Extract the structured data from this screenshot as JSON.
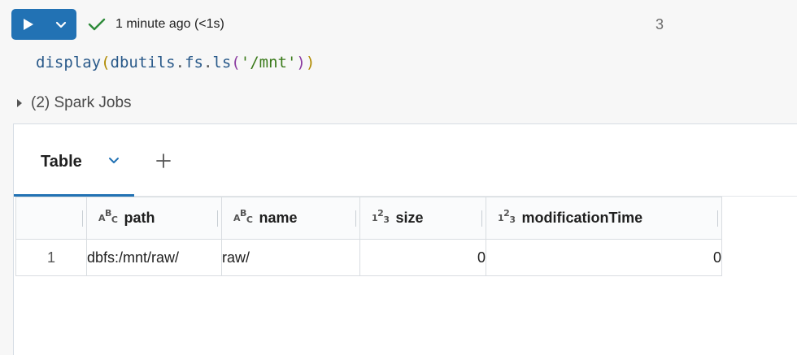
{
  "toolbar": {
    "status_text": "1 minute ago (<1s)",
    "cell_number": "3",
    "accent": "#2272b4",
    "success": "#2e8b3a"
  },
  "code": {
    "fn1": "display",
    "p1": "(",
    "mod": "dbutils",
    "d1": ".",
    "mod2": "fs",
    "d2": ".",
    "fn2": "ls",
    "p2": "(",
    "str": "'/mnt'",
    "p3": ")",
    "p4": ")"
  },
  "jobs": {
    "label": "(2) Spark Jobs"
  },
  "output": {
    "tab_label": "Table",
    "icons": {
      "run": "play-icon",
      "caret": "chevron-down-icon",
      "add": "plus-icon",
      "check": "check-icon"
    },
    "columns": [
      {
        "type": "A B C",
        "type_sym": [
          "A",
          "B",
          "C"
        ],
        "name": "path"
      },
      {
        "type": "A B C",
        "type_sym": [
          "A",
          "B",
          "C"
        ],
        "name": "name"
      },
      {
        "type": "1 2 3",
        "type_sym": [
          "1",
          "2",
          "3"
        ],
        "name": "size"
      },
      {
        "type": "1 2 3",
        "type_sym": [
          "1",
          "2",
          "3"
        ],
        "name": "modificationTime"
      }
    ],
    "rows": [
      {
        "index": "1",
        "path": "dbfs:/mnt/raw/",
        "name": "raw/",
        "size": "0",
        "modificationTime": "0"
      }
    ]
  }
}
